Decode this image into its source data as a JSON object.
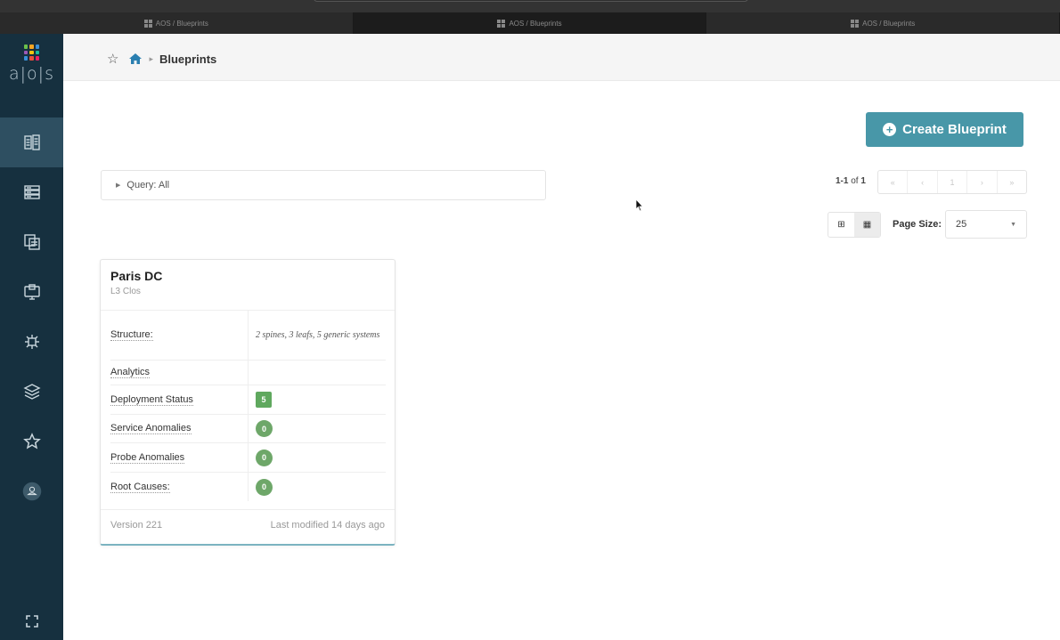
{
  "browser": {
    "tabs": [
      {
        "label": "AOS / Blueprints"
      },
      {
        "label": "AOS / Blueprints"
      },
      {
        "label": "AOS / Blueprints"
      }
    ]
  },
  "logo": {
    "text": "a|o|s",
    "colors": [
      "#6bc04b",
      "#f5a623",
      "#e94f3a",
      "#3a8fd8",
      "#9b59b6",
      "#f1c40f",
      "#1abc9c",
      "#e91e63",
      "#ffffff"
    ]
  },
  "sidebar": {
    "items": [
      {
        "icon": "blueprints-icon",
        "active": true
      },
      {
        "icon": "devices-icon",
        "active": false
      },
      {
        "icon": "design-icon",
        "active": false
      },
      {
        "icon": "resources-icon",
        "active": false
      },
      {
        "icon": "external-systems-icon",
        "active": false
      },
      {
        "icon": "layers-icon",
        "active": false
      },
      {
        "icon": "favorites-icon",
        "active": false
      },
      {
        "icon": "user-icon",
        "active": false
      }
    ],
    "expand_icon": "expand-icon"
  },
  "breadcrumb": {
    "current": "Blueprints"
  },
  "actions": {
    "create_label": "Create Blueprint"
  },
  "query": {
    "label": "Query: All"
  },
  "pagination": {
    "range": "1-1",
    "of_label": "of",
    "total": "1",
    "page_size_label": "Page Size:",
    "page_size": "25"
  },
  "blueprints": [
    {
      "name": "Paris DC",
      "type": "L3 Clos",
      "rows": [
        {
          "label": "Structure:",
          "value": "2 spines, 3 leafs, 5 generic systems"
        },
        {
          "label": "Analytics",
          "value": ""
        },
        {
          "label": "Deployment Status",
          "badge": "5"
        },
        {
          "label": "Service Anomalies",
          "badge": "0"
        },
        {
          "label": "Probe Anomalies",
          "badge": "0"
        },
        {
          "label": "Root Causes:",
          "badge": "0"
        }
      ],
      "version": "Version 221",
      "modified": "Last modified 14 days ago"
    }
  ],
  "colors": {
    "sidebar": "#16303f",
    "accent": "#4897a8",
    "success": "#5fa85e"
  }
}
